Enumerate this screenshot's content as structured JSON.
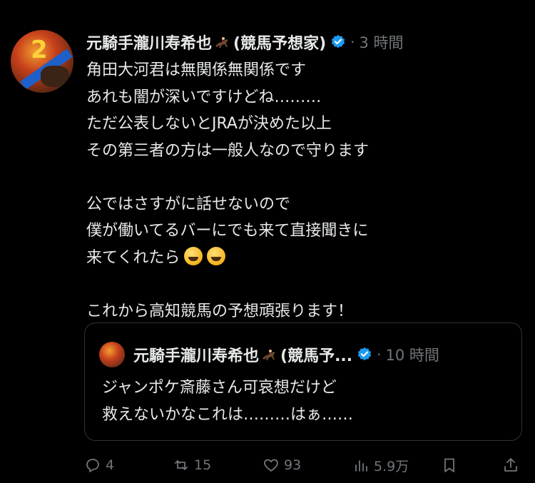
{
  "post": {
    "author_name": "元騎手瀧川寿希也",
    "author_suffix": "(競馬予想家)",
    "time": "3 時間",
    "separator": "·",
    "lines": [
      "角田大河君は無関係無関係です",
      "あれも闇が深いですけどね………",
      "ただ公表しないとJRAが決めた以上",
      "その第三者の方は一般人なので守ります",
      "",
      "公ではさすがに話せないので",
      "僕が働いてるバーにでも来て直接聞きに",
      "来てくれたら",
      "",
      "これから高知競馬の予想頑張ります！"
    ]
  },
  "quote": {
    "author_name": "元騎手瀧川寿希也",
    "author_suffix": "(競馬予...",
    "time": "10 時間",
    "separator": "·",
    "lines": [
      "ジャンポケ斎藤さん可哀想だけど",
      "救えないかなこれは………はぁ……"
    ]
  },
  "actions": {
    "replies": "4",
    "reposts": "15",
    "likes": "93",
    "views": "5.9万"
  },
  "icons": {
    "verified": "verified-badge-icon",
    "jockey": "horse-racing-icon",
    "emoji": "grinning-sweat-emoji",
    "reply": "reply-icon",
    "repost": "repost-icon",
    "like": "heart-icon",
    "views": "views-chart-icon",
    "bookmark": "bookmark-icon",
    "share": "share-icon"
  },
  "colors": {
    "background": "#000000",
    "text": "#e7e9ea",
    "muted": "#71767b",
    "verified": "#1d9bf0",
    "border": "#2f3336"
  }
}
